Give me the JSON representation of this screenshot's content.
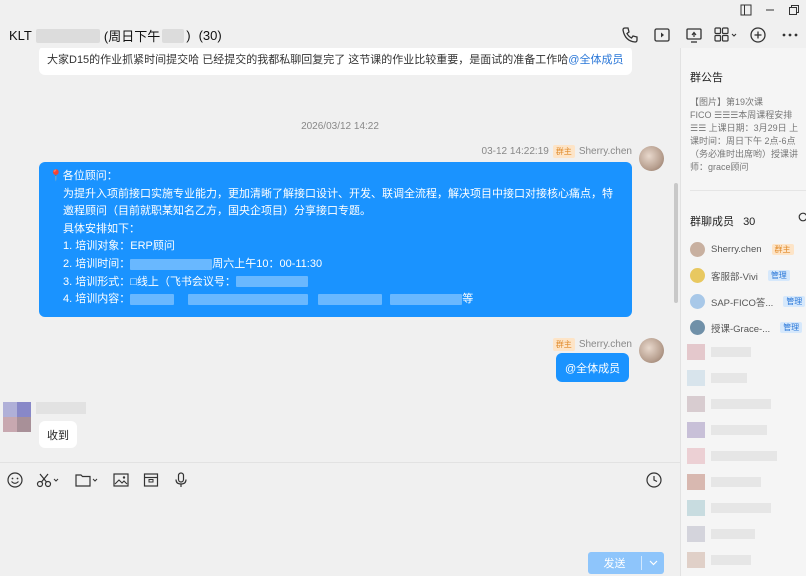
{
  "window": {
    "title_prefix": "KLT",
    "title_middle": "(周日下午",
    "title_suffix": ")",
    "member_count_label": "(30)",
    "controls": [
      "sidebar-toggle-icon",
      "minimize-icon",
      "restore-icon"
    ]
  },
  "header_icons": [
    "phone-icon",
    "video-icon",
    "screen-share-icon",
    "apps-icon",
    "add-circle-icon",
    "more-icon"
  ],
  "messages": {
    "top_text": "大家D15的作业抓紧时间提交哈   已经提交的我都私聊回复完了   这节课的作业比较重要，是面试的准备工作哈",
    "top_mention": "@全体成员",
    "timestamp": "2026/03/12 14:22",
    "sender_time": "03-12 14:22:19",
    "sender_badge": "群主",
    "sender_name": "Sherry.chen",
    "notice_lines": [
      "各位顾问：",
      "为提升入项前接口实施专业能力，更加清晰了解接口设计、开发、联调全流程，解决项目中接口对接核心痛点，特邀程顾问（目前就职某知名乙方，国央企项目）分享接口专题。",
      "具体安排如下：",
      "1. 培训对象：ERP顾问",
      "2. 培训时间：",
      "周六上午10：00-11:30",
      "3. 培训形式：□线上（飞书会议号：",
      "4. 培训内容：",
      "等"
    ],
    "pin_emoji": "📍",
    "mention_all": "@全体成员",
    "reply_received": "收到"
  },
  "input": {
    "send_label": "发送",
    "toolbar_icons": [
      "emoji-icon",
      "scissors-icon",
      "folder-icon",
      "image-icon",
      "package-icon",
      "microphone-icon",
      "clock-icon"
    ]
  },
  "right_panel": {
    "announcement_title": "群公告",
    "announcement_lines": [
      "【图片】第19次课",
      "FICO ☰☰☰本周课程安排",
      "☰☰ 上课日期：3月29日 上",
      "课时间：周日下午 2点-6点",
      "（务必准时出席哟）授课讲",
      "师：grace顾问"
    ],
    "members_title": "群聊成员",
    "members_count": "30",
    "members": [
      {
        "name": "Sherry.chen",
        "tag": "群主",
        "tag_type": "owner",
        "avatar_color": "#c8b0a0"
      },
      {
        "name": "客服部-Vivi",
        "tag": "管理",
        "tag_type": "admin",
        "avatar_color": "#e8c860"
      },
      {
        "name": "SAP-FICO答...",
        "tag": "管理",
        "tag_type": "admin",
        "avatar_color": "#a8c8e8"
      },
      {
        "name": "授课-Grace-...",
        "tag": "管理",
        "tag_type": "admin",
        "avatar_color": "#7090a8"
      }
    ]
  }
}
